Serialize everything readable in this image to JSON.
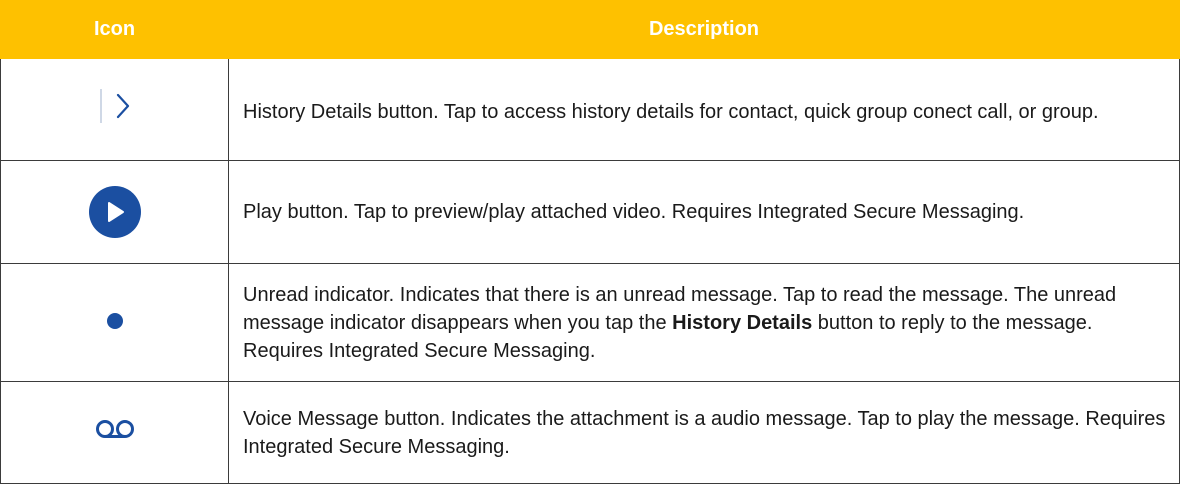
{
  "header": {
    "icon_col": "Icon",
    "desc_col": "Description"
  },
  "rows": [
    {
      "icon": "chevron-right-icon",
      "description": "History Details button. Tap to access history details for contact, quick group conect call, or group."
    },
    {
      "icon": "play-circle-icon",
      "description": "Play button. Tap to preview/play attached video. Requires Integrated Secure Messaging."
    },
    {
      "icon": "unread-dot-icon",
      "description_before": "Unread indicator. Indicates that there is an unread message. Tap to read the message. The unread message indicator disappears when you tap the ",
      "description_bold": "History Details",
      "description_after": " button to reply to the message. Requires Integrated Secure Messaging."
    },
    {
      "icon": "voicemail-icon",
      "description": "Voice Message button. Indicates the attachment is a audio message. Tap to play the message. Requires Integrated Secure Messaging."
    }
  ],
  "colors": {
    "header_bg": "#fec100",
    "header_text": "#ffffff",
    "icon_blue": "#1b4fa1"
  }
}
